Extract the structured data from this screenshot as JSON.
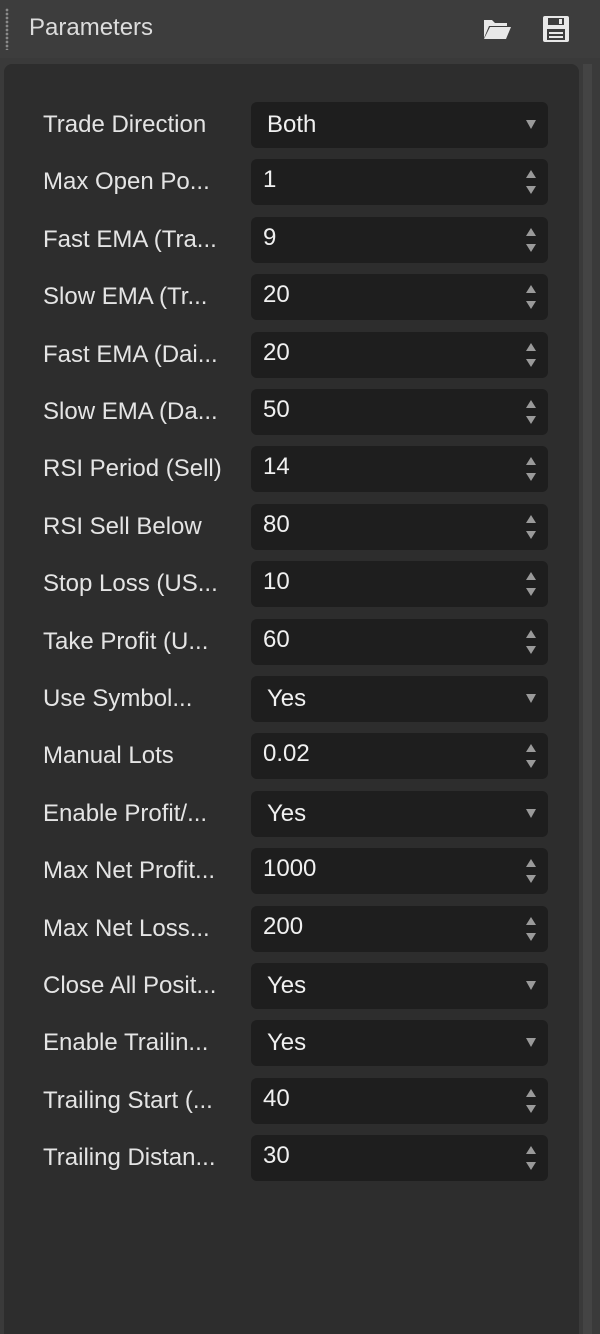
{
  "header": {
    "title": "Parameters",
    "open_icon": "folder-open-icon",
    "save_icon": "floppy-disk-icon"
  },
  "colors": {
    "background": "#3a3a3a",
    "panel": "#2d2d2d",
    "field": "#1e1e1e",
    "text": "#e4e4e4",
    "arrow": "#9a9a9a"
  },
  "params": [
    {
      "label": "Trade Direction",
      "value": "Both",
      "kind": "dropdown"
    },
    {
      "label": "Max Open Po...",
      "value": "1",
      "kind": "numeric"
    },
    {
      "label": "Fast EMA (Tra...",
      "value": "9",
      "kind": "numeric"
    },
    {
      "label": "Slow EMA (Tr...",
      "value": "20",
      "kind": "numeric"
    },
    {
      "label": "Fast EMA (Dai...",
      "value": "20",
      "kind": "numeric"
    },
    {
      "label": "Slow EMA (Da...",
      "value": "50",
      "kind": "numeric"
    },
    {
      "label": "RSI Period (Sell)",
      "value": "14",
      "kind": "numeric"
    },
    {
      "label": "RSI Sell Below",
      "value": "80",
      "kind": "numeric"
    },
    {
      "label": "Stop Loss (US...",
      "value": "10",
      "kind": "numeric"
    },
    {
      "label": "Take Profit (U...",
      "value": "60",
      "kind": "numeric"
    },
    {
      "label": "Use Symbol...",
      "value": "Yes",
      "kind": "dropdown"
    },
    {
      "label": "Manual Lots",
      "value": "0.02",
      "kind": "numeric"
    },
    {
      "label": "Enable Profit/...",
      "value": "Yes",
      "kind": "dropdown"
    },
    {
      "label": "Max Net Profit...",
      "value": "1000",
      "kind": "numeric"
    },
    {
      "label": "Max Net Loss...",
      "value": "200",
      "kind": "numeric"
    },
    {
      "label": "Close All Posit...",
      "value": "Yes",
      "kind": "dropdown"
    },
    {
      "label": "Enable Trailin...",
      "value": "Yes",
      "kind": "dropdown"
    },
    {
      "label": "Trailing Start (...",
      "value": "40",
      "kind": "numeric"
    },
    {
      "label": "Trailing Distan...",
      "value": "30",
      "kind": "numeric"
    }
  ]
}
